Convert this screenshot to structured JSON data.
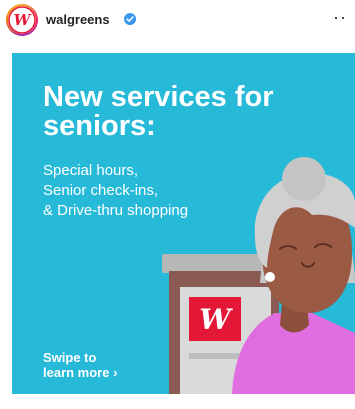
{
  "header": {
    "account_name": "walgreens",
    "avatar_icon": "walgreens-w-logo-icon",
    "verified_icon": "verified-badge-icon",
    "more_icon": "more-options-icon",
    "brand_color": "#e31837",
    "verified_color": "#3897f0"
  },
  "post": {
    "background_color": "#27b9d8",
    "headline": "New services for seniors:",
    "services": [
      "Special hours,",
      "Senior check-ins,",
      "& Drive-thru shopping"
    ],
    "swipe_line1": "Swipe to",
    "swipe_line2": "learn more",
    "swipe_chevron": "›",
    "store_logo_icon": "walgreens-w-logo-icon"
  }
}
